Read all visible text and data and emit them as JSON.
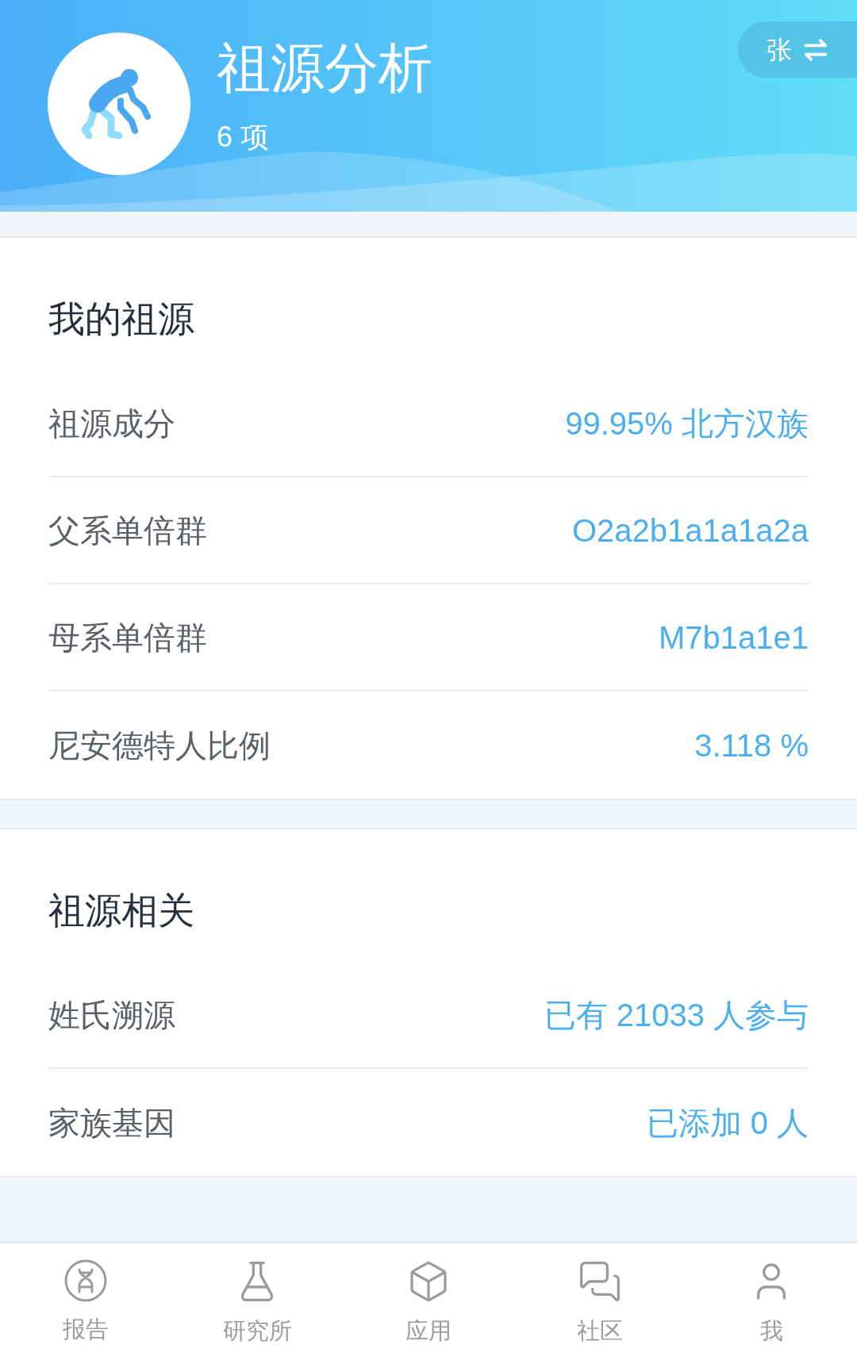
{
  "header": {
    "title": "祖源分析",
    "count": "6 项",
    "switch_button": {
      "label": "张"
    }
  },
  "sections": [
    {
      "heading": "我的祖源",
      "rows": [
        {
          "label": "祖源成分",
          "value": "99.95% 北方汉族"
        },
        {
          "label": "父系单倍群",
          "value": "O2a2b1a1a1a2a"
        },
        {
          "label": "母系单倍群",
          "value": "M7b1a1e1"
        },
        {
          "label": "尼安德特人比例",
          "value": "3.118 %"
        }
      ]
    },
    {
      "heading": "祖源相关",
      "rows": [
        {
          "label": "姓氏溯源",
          "value": "已有 21033 人参与"
        },
        {
          "label": "家族基因",
          "value": "已添加 0 人"
        }
      ]
    }
  ],
  "tab_bar": {
    "tabs": [
      {
        "label": "报告",
        "kind": "dna",
        "selected": false
      },
      {
        "label": "研究所",
        "kind": "flask",
        "selected": false
      },
      {
        "label": "应用",
        "kind": "cube",
        "selected": false
      },
      {
        "label": "社区",
        "kind": "chat",
        "selected": false
      },
      {
        "label": "我",
        "kind": "user",
        "selected": false
      }
    ]
  }
}
